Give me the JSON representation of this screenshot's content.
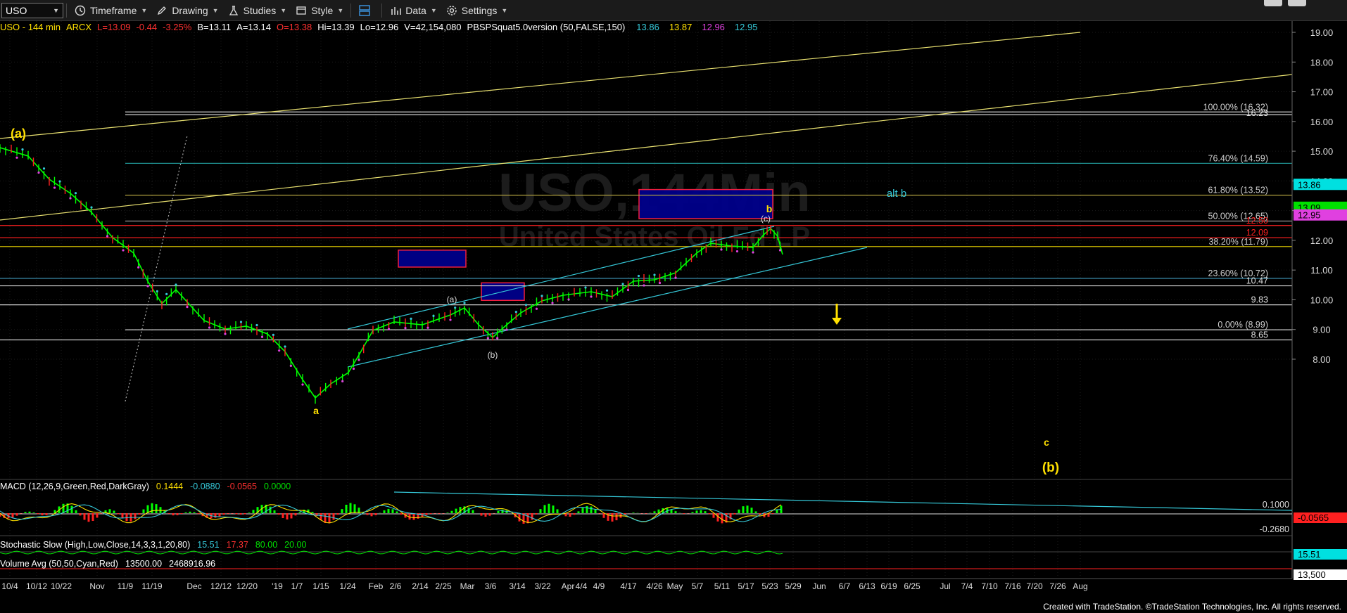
{
  "toolbar": {
    "symbol": "USO",
    "timeframe": "Timeframe",
    "drawing": "Drawing",
    "studies": "Studies",
    "style": "Style",
    "data": "Data",
    "settings": "Settings"
  },
  "header": {
    "symbol_interval": "USO - 144 min",
    "exchange": "ARCX",
    "last": "L=13.09",
    "change": "-0.44",
    "change_pct": "-3.25%",
    "bid": "B=13.11",
    "ask": "A=13.14",
    "open": "O=13.38",
    "high": "Hi=13.39",
    "low": "Lo=12.96",
    "volume": "V=42,154,080",
    "study": "PBSPSquat5.0version (50,FALSE,150)",
    "study_v1": "13.86",
    "study_v2": "13.87",
    "study_v3": "12.96",
    "study_v4": "12.95"
  },
  "watermark": {
    "line1": "USO,144Min",
    "line2": "United States Oil Fd LP"
  },
  "colors": {
    "up": "#00ff00",
    "down": "#ff2020",
    "cyan": "#35c8d8",
    "yellow": "#ffe000",
    "magenta": "#e040e0",
    "blue_box": "#00008b"
  },
  "wave_labels": {
    "a_big": "(a)",
    "a": "a",
    "a_paren": "(a)",
    "b_paren": "(b)",
    "c_paren": "(c)",
    "b": "b",
    "alt_b": "alt b",
    "c": "c",
    "b_big": "(b)"
  },
  "price_axis": [
    "19.00",
    "18.00",
    "17.00",
    "16.00",
    "15.00",
    "14.00",
    "13.00",
    "12.00",
    "11.00",
    "10.00",
    "9.00",
    "8.00"
  ],
  "fib_labels": [
    {
      "text": "100.00% (16.32)",
      "price": 16.32
    },
    {
      "text": "76.40% (14.59)",
      "price": 14.59
    },
    {
      "text": "61.80% (13.52)",
      "price": 13.52
    },
    {
      "text": "50.00% (12.65)",
      "price": 12.65
    },
    {
      "text": "38.20% (11.79)",
      "price": 11.79
    },
    {
      "text": "23.60% (10.72)",
      "price": 10.72
    },
    {
      "text": "0.00% (8.99)",
      "price": 8.99
    }
  ],
  "level_labels": [
    {
      "text": "16.23",
      "price": 16.23
    },
    {
      "text": "12.50",
      "price": 12.5
    },
    {
      "text": "12.09",
      "price": 12.09
    },
    {
      "text": "10.47",
      "price": 10.47
    },
    {
      "text": "9.83",
      "price": 9.83
    },
    {
      "text": "8.65",
      "price": 8.65
    }
  ],
  "price_tags": [
    {
      "text": "13.86",
      "price": 13.86
    },
    {
      "text": "13.09",
      "price": 13.09
    },
    {
      "text": "12.95",
      "price": 12.95
    }
  ],
  "macd": {
    "label": "MACD (12,26,9,Green,Red,DarkGray)",
    "v1": "0.1444",
    "v2": "-0.0880",
    "v3": "-0.0565",
    "v4": "0.0000",
    "axis_top": "0.1000",
    "axis_bottom": "-0.2680",
    "tag": "-0.0565"
  },
  "stoch": {
    "label": "Stochastic Slow (High,Low,Close,14,3,3,1,20,80)",
    "v1": "15.51",
    "v2": "17.37",
    "v3": "80.00",
    "v4": "20.00",
    "tag": "15.51"
  },
  "volavg": {
    "label": "Volume Avg (50,50,Cyan,Red)",
    "v1": "13500.00",
    "v2": "2468916.96",
    "tag": "13,500"
  },
  "time_axis": [
    "10/4",
    "10/12",
    "10/22",
    "Nov",
    "11/9",
    "11/19",
    "Dec",
    "12/12",
    "12/20",
    "'19",
    "1/7",
    "1/15",
    "1/24",
    "Feb",
    "2/6",
    "2/14",
    "2/25",
    "Mar",
    "3/6",
    "3/14",
    "3/22",
    "Apr",
    "4/4",
    "4/9",
    "4/17",
    "4/26",
    "May",
    "5/7",
    "5/11",
    "5/17",
    "5/23",
    "5/29",
    "Jun",
    "6/7",
    "6/13",
    "6/19",
    "6/25",
    "Jul",
    "7/4",
    "7/10",
    "7/16",
    "7/20",
    "7/26",
    "Aug"
  ],
  "footer": "Created with TradeStation. ©TradeStation Technologies, Inc. All rights reserved."
}
